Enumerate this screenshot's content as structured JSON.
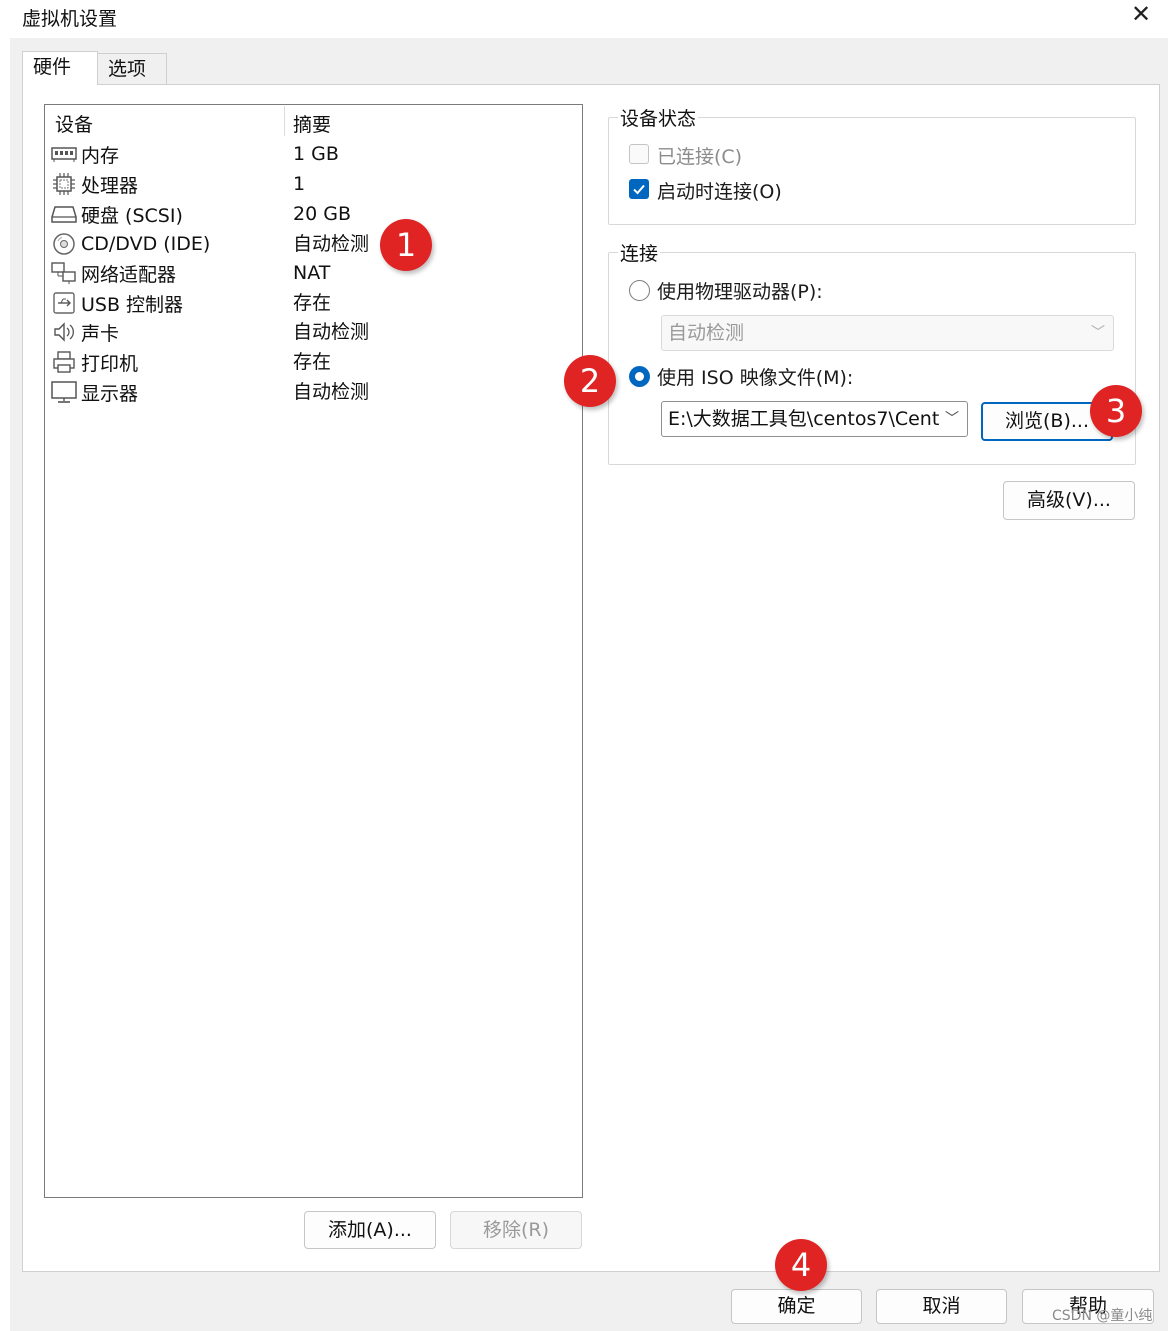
{
  "window": {
    "title": "虚拟机设置",
    "close_glyph": "✕"
  },
  "tabs": [
    {
      "label": "硬件"
    },
    {
      "label": "选项"
    }
  ],
  "device_list": {
    "headers": {
      "device": "设备",
      "summary": "摘要"
    },
    "rows": [
      {
        "name": "内存",
        "summary": "1 GB",
        "icon": "memory-icon"
      },
      {
        "name": "处理器",
        "summary": "1",
        "icon": "processor-icon"
      },
      {
        "name": "硬盘 (SCSI)",
        "summary": "20 GB",
        "icon": "hard-disk-icon"
      },
      {
        "name": "CD/DVD (IDE)",
        "summary": "自动检测",
        "icon": "cd-dvd-icon"
      },
      {
        "name": "网络适配器",
        "summary": "NAT",
        "icon": "network-adapter-icon"
      },
      {
        "name": "USB 控制器",
        "summary": "存在",
        "icon": "usb-icon"
      },
      {
        "name": "声卡",
        "summary": "自动检测",
        "icon": "speaker-icon"
      },
      {
        "name": "打印机",
        "summary": "存在",
        "icon": "printer-icon"
      },
      {
        "name": "显示器",
        "summary": "自动检测",
        "icon": "monitor-icon"
      }
    ],
    "add_label": "添加(A)...",
    "remove_label": "移除(R)"
  },
  "device_status": {
    "title": "设备状态",
    "connected_label": "已连接(C)",
    "connected_checked": false,
    "connect_at_power_on_label": "启动时连接(O)",
    "connect_at_power_on_checked": true
  },
  "connection": {
    "title": "连接",
    "physical_drive_label": "使用物理驱动器(P):",
    "physical_drive_value": "自动检测",
    "iso_label": "使用 ISO 映像文件(M):",
    "iso_value": "E:\\大数据工具包\\centos7\\Cent",
    "browse_label": "浏览(B)...",
    "selected": "iso"
  },
  "advanced_label": "高级(V)...",
  "footer": {
    "ok_label": "确定",
    "cancel_label": "取消",
    "help_label": "帮助"
  },
  "annotations": {
    "badge1": "1",
    "badge2": "2",
    "badge3": "3",
    "badge4": "4"
  },
  "watermark": "CSDN @童小纯",
  "colors": {
    "accent": "#0067c0",
    "badge": "#e02424"
  }
}
